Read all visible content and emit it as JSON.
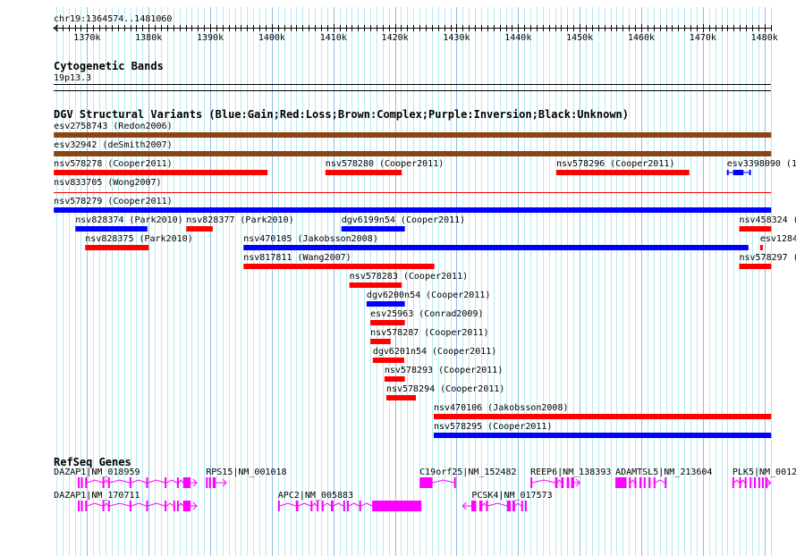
{
  "view": {
    "range_label": "chr19:1364574..1481060",
    "start_kb": 1364.574,
    "end_kb": 1481.06,
    "tick_labels": [
      "1370k",
      "1380k",
      "1390k",
      "1400k",
      "1410k",
      "1420k",
      "1430k",
      "1440k",
      "1450k",
      "1460k",
      "1470k",
      "1480k"
    ]
  },
  "colors": {
    "gain": "#0000ff",
    "loss": "#ff0000",
    "complex": "#8b4513",
    "gene": "#ff00ff",
    "grid_minor": "#b4e9f0",
    "grid_major": "#8fbde3"
  },
  "cytoband": {
    "title": "Cytogenetic Bands",
    "band": "19p13.3"
  },
  "dgv": {
    "title": "DGV Structural Variants (Blue:Gain;Red:Loss;Brown:Complex;Purple:Inversion;Black:Unknown)",
    "rows": [
      [
        {
          "label": "esv2758743 (Redon2006)",
          "type": "complex",
          "start": 1364.6,
          "end": 1481.1
        }
      ],
      [
        {
          "label": "esv32942 (deSmith2007)",
          "type": "complex",
          "start": 1364.6,
          "end": 1481.1
        }
      ],
      [
        {
          "label": "nsv578278 (Cooper2011)",
          "type": "loss",
          "start": 1364.6,
          "end": 1399.3
        },
        {
          "label": "nsv578280 (Cooper2011)",
          "type": "loss",
          "start": 1408.7,
          "end": 1421.1
        },
        {
          "label": "nsv578296 (Cooper2011)",
          "type": "loss",
          "start": 1446.2,
          "end": 1467.8
        },
        {
          "label": "esv3398090 (1",
          "type": "gain",
          "start": 1473.9,
          "end": 1477.8,
          "thick_start": 1474.9,
          "thick_end": 1476.6
        }
      ],
      [
        {
          "label": "nsv833705 (Wong2007)",
          "type": "loss",
          "start": 1364.6,
          "end": 1481.1,
          "thin": true
        }
      ],
      [
        {
          "label": "nsv578279 (Cooper2011)",
          "type": "gain",
          "start": 1364.6,
          "end": 1481.1
        }
      ],
      [
        {
          "label": "nsv828374 (Park2010)",
          "type": "gain",
          "start": 1368.1,
          "end": 1379.8
        },
        {
          "label": "nsv828377 (Park2010)",
          "type": "loss",
          "start": 1386.1,
          "end": 1390.4
        },
        {
          "label": "dgv6199n54 (Cooper2011)",
          "type": "gain",
          "start": 1411.3,
          "end": 1421.6
        },
        {
          "label": "nsv458324 (",
          "type": "loss",
          "start": 1475.9,
          "end": 1481.1
        }
      ],
      [
        {
          "label": "nsv828375 (Park2010)",
          "type": "loss",
          "start": 1369.7,
          "end": 1380.0
        },
        {
          "label": "nsv470105 (Jakobsson2008)",
          "type": "gain",
          "start": 1395.4,
          "end": 1477.4
        },
        {
          "label": "esv1284",
          "type": "loss",
          "start": 1479.3,
          "end": 1479.7
        }
      ],
      [
        {
          "label": "nsv817811 (Wang2007)",
          "type": "loss",
          "start": 1395.4,
          "end": 1426.4
        },
        {
          "label": "nsv578297 (",
          "type": "loss",
          "start": 1475.9,
          "end": 1481.1
        }
      ],
      [
        {
          "label": "nsv578283 (Cooper2011)",
          "type": "loss",
          "start": 1412.6,
          "end": 1421.1
        }
      ],
      [
        {
          "label": "dgv6200n54 (Cooper2011)",
          "type": "gain",
          "start": 1415.4,
          "end": 1421.6
        }
      ],
      [
        {
          "label": "esv25963 (Conrad2009)",
          "type": "loss",
          "start": 1416.0,
          "end": 1421.6
        }
      ],
      [
        {
          "label": "nsv578287 (Cooper2011)",
          "type": "loss",
          "start": 1416.0,
          "end": 1419.3
        }
      ],
      [
        {
          "label": "dgv6201n54 (Cooper2011)",
          "type": "loss",
          "start": 1416.4,
          "end": 1421.5
        }
      ],
      [
        {
          "label": "nsv578293 (Cooper2011)",
          "type": "loss",
          "start": 1418.3,
          "end": 1421.6
        }
      ],
      [
        {
          "label": "nsv578294 (Cooper2011)",
          "type": "loss",
          "start": 1418.6,
          "end": 1423.4
        }
      ],
      [
        {
          "label": "nsv470106 (Jakobsson2008)",
          "type": "loss",
          "start": 1426.3,
          "end": 1481.1
        }
      ],
      [
        {
          "label": "nsv578295 (Cooper2011)",
          "type": "gain",
          "start": 1426.3,
          "end": 1481.1
        }
      ]
    ]
  },
  "refseq": {
    "title": "RefSeq Genes",
    "rows": [
      [
        {
          "label": "DAZAP1|NM_018959",
          "strand": "+",
          "start": 1364.6,
          "end": 1387.8,
          "exons": [
            [
              1368.5,
              1368.8
            ],
            [
              1369.0,
              1369.3
            ],
            [
              1369.7,
              1370.0
            ],
            [
              1372.5,
              1372.8
            ],
            [
              1373.4,
              1373.7
            ],
            [
              1376.9,
              1377.2
            ],
            [
              1379.6,
              1379.9
            ],
            [
              1382.6,
              1382.9
            ],
            [
              1384.6,
              1384.9
            ],
            [
              1385.6,
              1386.8
            ]
          ]
        },
        {
          "label": "RPS15|NM_001018",
          "strand": "+",
          "start": 1389.3,
          "end": 1392.6,
          "exons": [
            [
              1389.3,
              1389.6
            ],
            [
              1389.8,
              1390.1
            ],
            [
              1390.4,
              1390.9
            ]
          ]
        },
        {
          "label": "C19orf25|NM_152482",
          "strand": "",
          "start": 1424.0,
          "end": 1429.9,
          "exons": [
            [
              1424.0,
              1426.1
            ],
            [
              1429.6,
              1429.9
            ]
          ]
        },
        {
          "label": "REEP6|NM_138393",
          "strand": "+",
          "start": 1442.0,
          "end": 1450.0,
          "exons": [
            [
              1442.0,
              1442.3
            ],
            [
              1446.0,
              1446.4
            ],
            [
              1447.0,
              1447.4
            ],
            [
              1447.9,
              1448.3
            ],
            [
              1448.6,
              1449.1
            ]
          ]
        },
        {
          "label": "ADAMTSL5|NM_213604",
          "strand": "",
          "start": 1455.8,
          "end": 1464.0,
          "exons": [
            [
              1455.8,
              1457.6
            ],
            [
              1458.0,
              1458.3
            ],
            [
              1458.9,
              1459.2
            ],
            [
              1459.7,
              1460.0
            ],
            [
              1460.4,
              1460.7
            ],
            [
              1461.2,
              1461.5
            ],
            [
              1462.0,
              1462.3
            ],
            [
              1463.8,
              1464.0
            ]
          ]
        },
        {
          "label": "PLK5|NM_0012",
          "strand": "+",
          "start": 1474.8,
          "end": 1481.0,
          "exons": [
            [
              1474.8,
              1475.1
            ],
            [
              1475.9,
              1476.2
            ],
            [
              1476.8,
              1477.1
            ],
            [
              1477.6,
              1477.9
            ],
            [
              1478.3,
              1478.6
            ],
            [
              1479.0,
              1479.3
            ],
            [
              1479.6,
              1479.9
            ],
            [
              1480.2,
              1480.5
            ]
          ]
        }
      ],
      [
        {
          "label": "DAZAP1|NM_170711",
          "strand": "+",
          "start": 1364.6,
          "end": 1387.8,
          "exons": [
            [
              1368.5,
              1368.8
            ],
            [
              1369.0,
              1369.3
            ],
            [
              1369.7,
              1370.0
            ],
            [
              1372.5,
              1372.8
            ],
            [
              1373.4,
              1373.7
            ],
            [
              1376.9,
              1377.2
            ],
            [
              1379.6,
              1379.9
            ],
            [
              1382.6,
              1382.9
            ],
            [
              1384.0,
              1384.3
            ],
            [
              1384.6,
              1384.9
            ],
            [
              1385.6,
              1386.8
            ]
          ]
        },
        {
          "label": "APC2|NM_005883",
          "strand": "",
          "start": 1401.0,
          "end": 1424.3,
          "exons": [
            [
              1401.0,
              1401.3
            ],
            [
              1403.9,
              1404.3
            ],
            [
              1406.3,
              1406.6
            ],
            [
              1407.3,
              1407.6
            ],
            [
              1408.1,
              1408.4
            ],
            [
              1409.6,
              1410.0
            ],
            [
              1411.6,
              1411.9
            ],
            [
              1412.2,
              1412.5
            ],
            [
              1414.2,
              1414.5
            ],
            [
              1416.3,
              1424.3
            ]
          ]
        },
        {
          "label": "PCSK4|NM_017573",
          "strand": "-",
          "start": 1431.0,
          "end": 1441.4,
          "exons": [
            [
              1432.4,
              1433.2
            ],
            [
              1433.7,
              1434.2
            ],
            [
              1434.8,
              1435.1
            ],
            [
              1438.2,
              1438.8
            ],
            [
              1439.1,
              1439.5
            ],
            [
              1440.5,
              1440.8
            ],
            [
              1441.1,
              1441.4
            ]
          ]
        }
      ]
    ]
  }
}
